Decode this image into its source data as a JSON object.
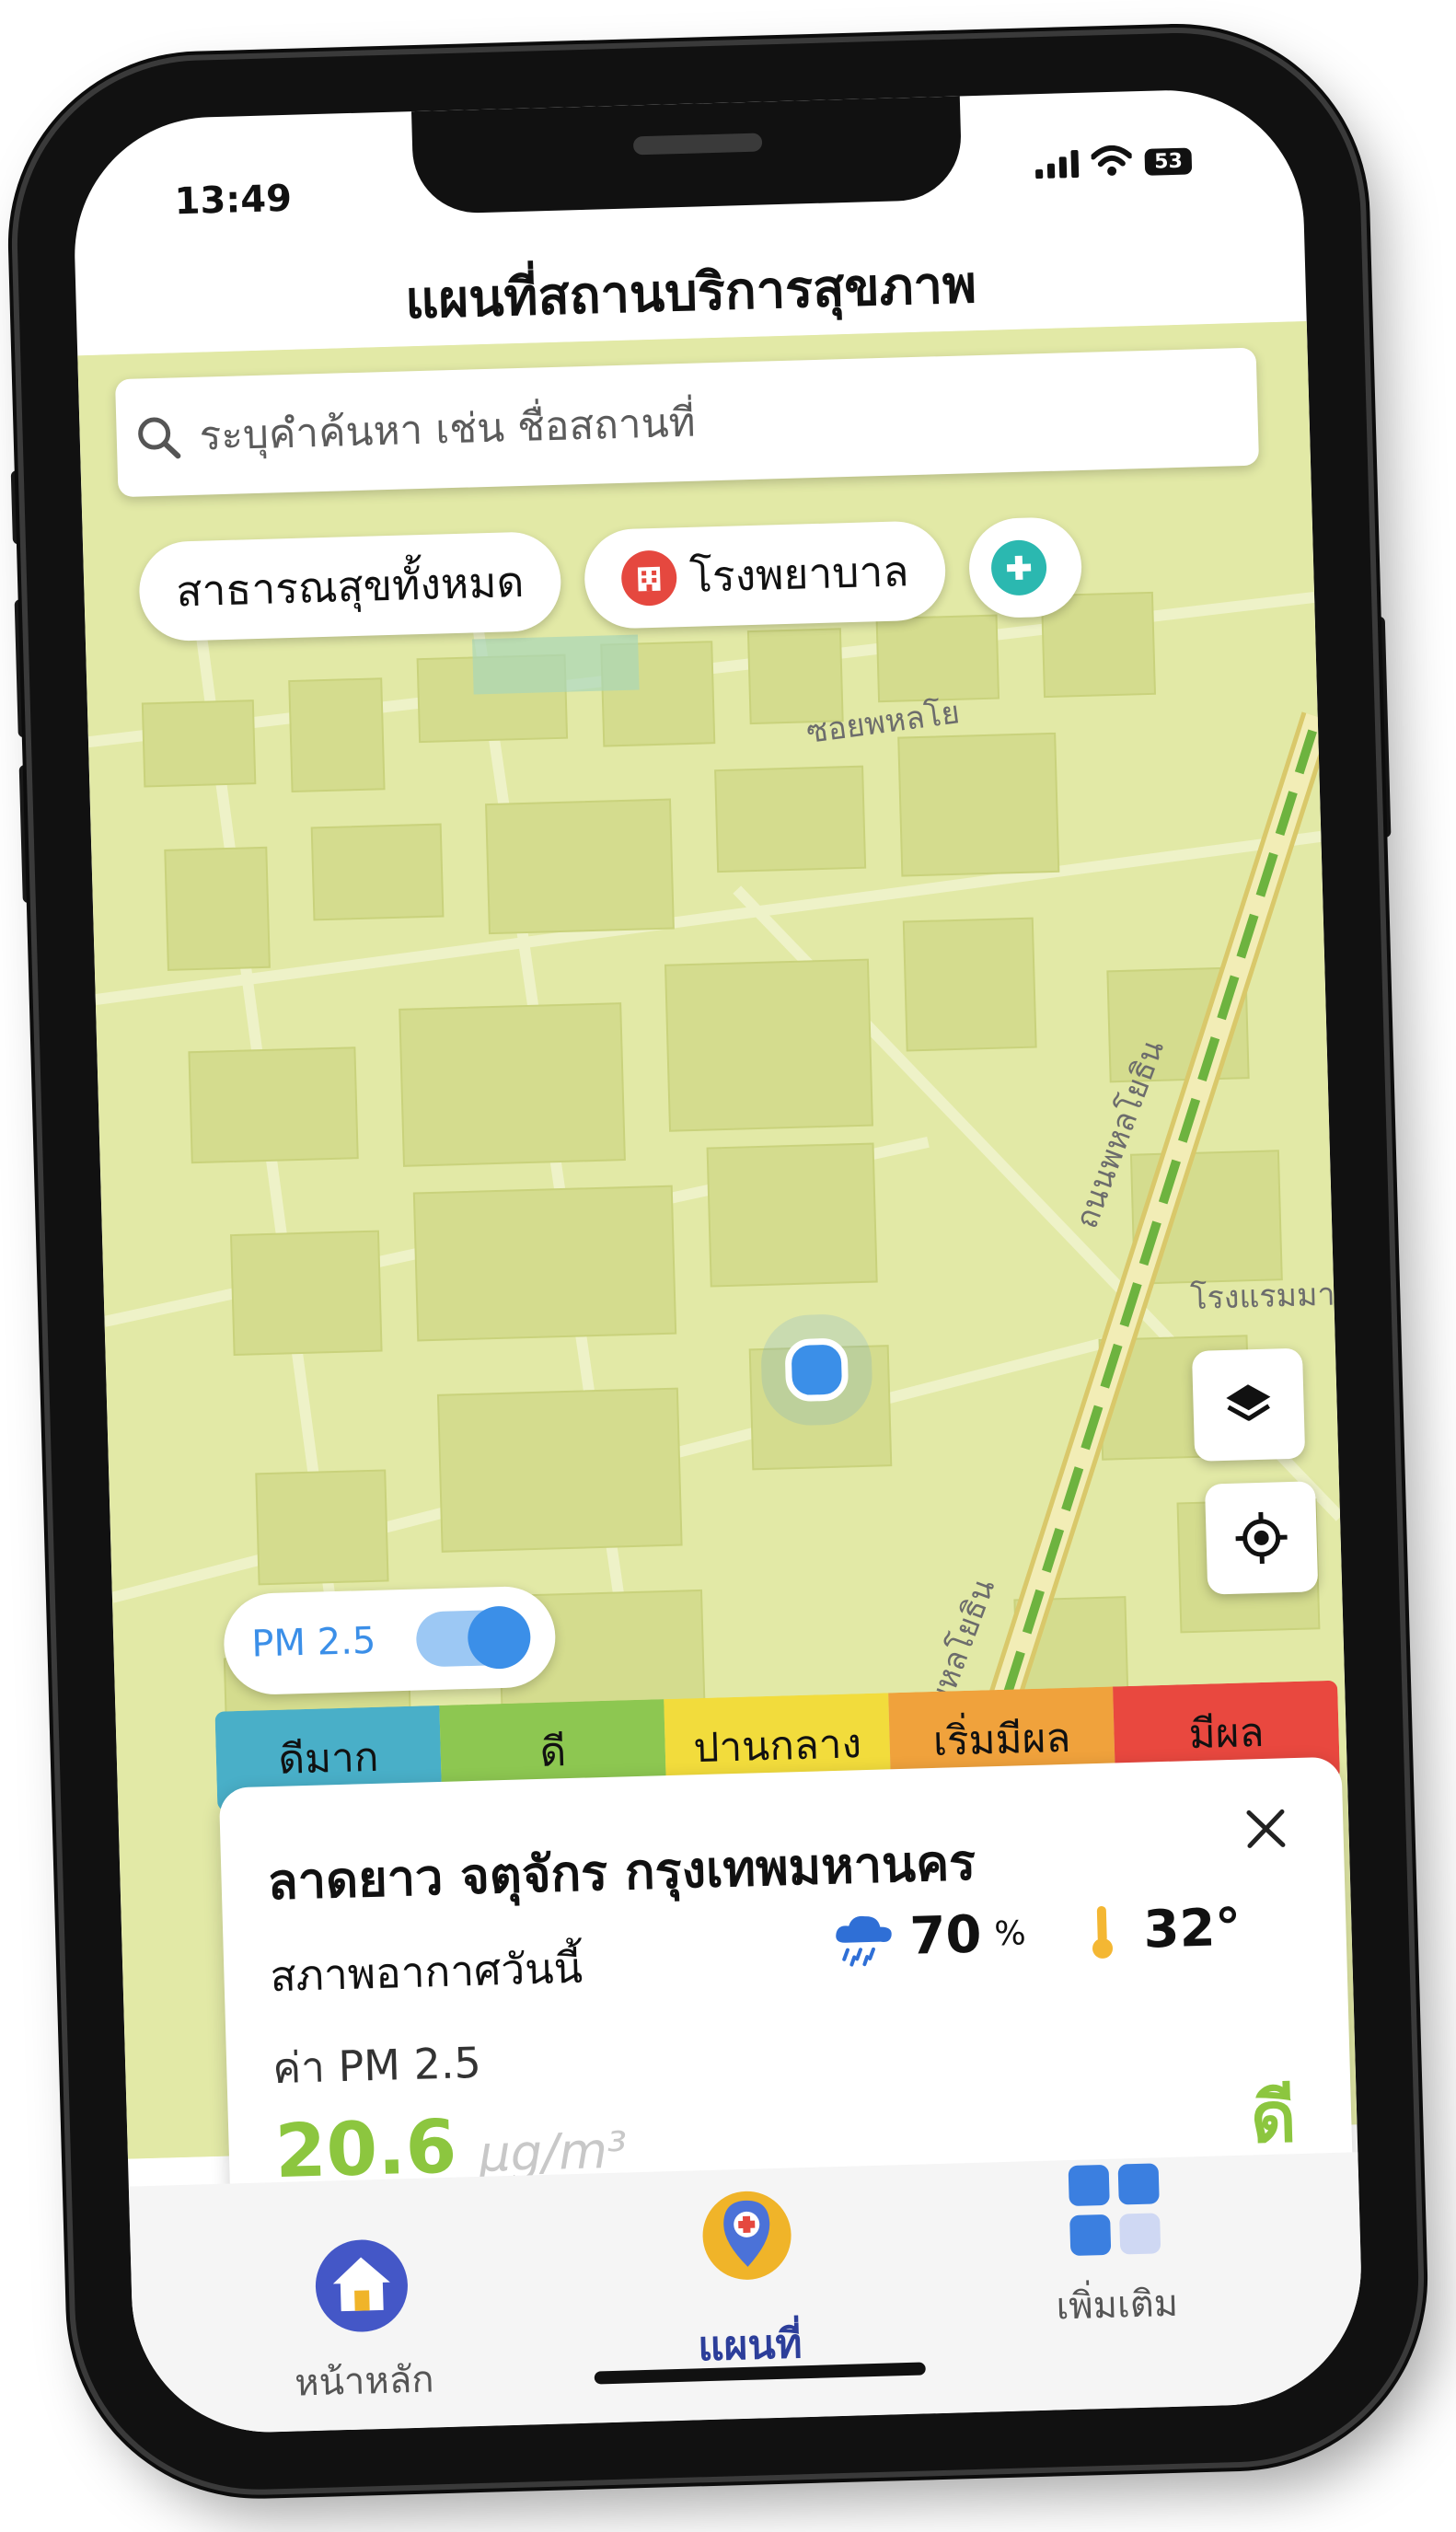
{
  "status_bar": {
    "time": "13:49",
    "battery": "53"
  },
  "app": {
    "title": "แผนที่สถานบริการสุขภาพ"
  },
  "search": {
    "placeholder": "ระบุคำค้นหา เช่น ชื่อสถานที่",
    "icon": "search-icon"
  },
  "filter_chips": [
    {
      "label": "สาธารณสุขทั้งหมด",
      "icon": ""
    },
    {
      "label": "โรงพยาบาล",
      "icon": "hospital-icon",
      "color": "#e5483f"
    },
    {
      "label": "",
      "icon": "clinic-icon",
      "color": "#2bb8b0"
    }
  ],
  "map": {
    "road_labels": [
      "ซอยพหลโย",
      "ถนนพหลโยธิน",
      "ถนนพหลโยธิน",
      "โรงแรมมา"
    ],
    "buttons": [
      {
        "icon": "layers-icon"
      },
      {
        "icon": "locate-icon"
      }
    ]
  },
  "pm_toggle": {
    "label": "PM 2.5",
    "on": true
  },
  "air_quality_scale": [
    {
      "label": "ดีมาก",
      "color": "#49afc8"
    },
    {
      "label": "ดี",
      "color": "#8dc751"
    },
    {
      "label": "ปานกลาง",
      "color": "#f2dc3c"
    },
    {
      "label": "เริ่มมีผล",
      "color": "#f0a23c"
    },
    {
      "label": "มีผล",
      "color": "#e9483f"
    }
  ],
  "info_card": {
    "location": "ลาดยาว จตุจักร กรุงเทพมหานคร",
    "weather_label": "สภาพอากาศวันนี้",
    "humidity": "70",
    "humidity_unit": "%",
    "temperature": "32°",
    "pm_label": "ค่า PM 2.5",
    "pm_value": "20.6",
    "pm_unit": "µg/m³",
    "level": "ดี",
    "level_color": "#8cc63f"
  },
  "tabs": [
    {
      "label": "หน้าหลัก",
      "icon": "home-icon",
      "active": false
    },
    {
      "label": "แผนที่",
      "icon": "map-pin-icon",
      "active": true
    },
    {
      "label": "เพิ่มเติม",
      "icon": "more-grid-icon",
      "active": false
    }
  ]
}
